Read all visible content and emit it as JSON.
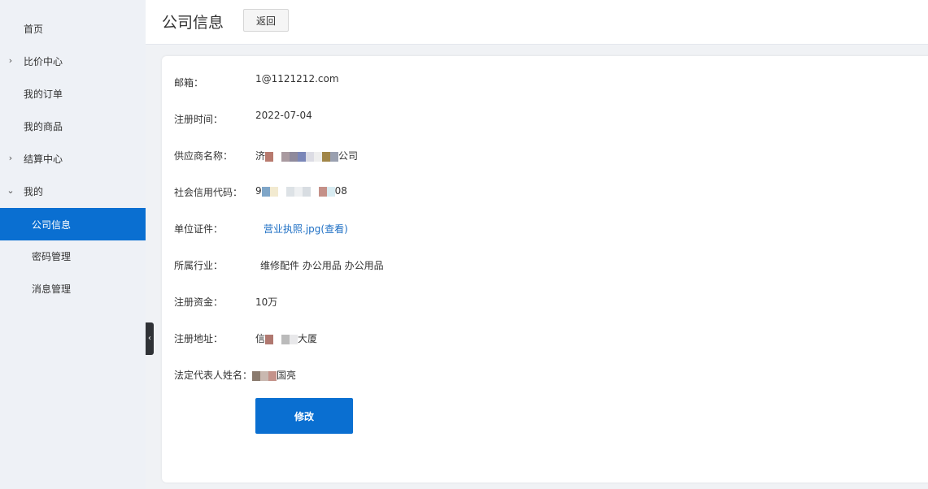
{
  "sidebar": {
    "items": [
      {
        "label": "首页"
      },
      {
        "label": "比价中心"
      },
      {
        "label": "我的订单"
      },
      {
        "label": "我的商品"
      },
      {
        "label": "结算中心"
      },
      {
        "label": "我的"
      },
      {
        "label": "公司信息"
      },
      {
        "label": "密码管理"
      },
      {
        "label": "消息管理"
      }
    ],
    "active_item": "公司信息"
  },
  "header": {
    "title": "公司信息",
    "back_label": "返回"
  },
  "info": {
    "email_label": "邮箱：",
    "email_value": "1@1121212.com",
    "reg_time_label": "注册时间：",
    "reg_time_value": "2022-07-04",
    "supplier_label": "供应商名称：",
    "supplier_prefix": "济",
    "supplier_suffix": "公司",
    "credit_label": "社会信用代码：",
    "credit_prefix": "9",
    "credit_suffix": "08",
    "license_label": "单位证件：",
    "license_value": "营业执照.jpg(查看)",
    "industry_label": "所属行业：",
    "industry_value": "维修配件  办公用品  办公用品",
    "capital_label": "注册资金：",
    "capital_value": "10万",
    "address_label": "注册地址：",
    "address_prefix": "信",
    "address_suffix": "大厦",
    "legal_label": "法定代表人姓名：",
    "legal_suffix": "国亮"
  },
  "actions": {
    "edit_label": "修改"
  },
  "colors": {
    "accent": "#0a6fd1",
    "link": "#1e6fc4",
    "sidebar_bg": "#eef1f6"
  }
}
